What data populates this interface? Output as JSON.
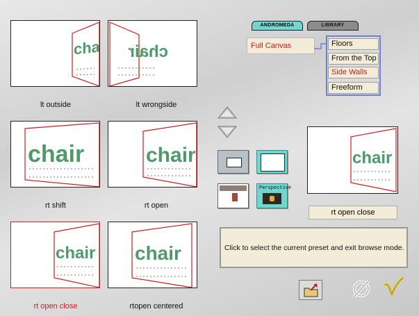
{
  "tabs": [
    {
      "label": "ANDROMEDA",
      "active": true
    },
    {
      "label": "LIBRARY",
      "active": false
    }
  ],
  "canvas_selector": {
    "label": "Full Canvas"
  },
  "menu": {
    "items": [
      {
        "label": "Floors",
        "active": false
      },
      {
        "label": "From the Top",
        "active": false
      },
      {
        "label": "Side Walls",
        "active": true
      },
      {
        "label": "Freeform",
        "active": false
      }
    ]
  },
  "thumb_word": "chair",
  "presets": [
    {
      "label": "lt outside",
      "selected": false
    },
    {
      "label": "lt wrongside",
      "selected": false
    },
    {
      "label": "rt shift",
      "selected": false
    },
    {
      "label": "rt open",
      "selected": false
    },
    {
      "label": "rt open close",
      "selected": true
    },
    {
      "label": "rtopen centered",
      "selected": false
    }
  ],
  "preview": {
    "label": "rt open close"
  },
  "info": {
    "text": "Click to select the current preset and exit browse mode."
  },
  "perspective_label": "Perspective",
  "colors": {
    "accent": "#d21a1a",
    "chair_green": "#4f9a6a",
    "menu_border": "#6b7fd6",
    "tab_active": "#6fd6d0"
  }
}
